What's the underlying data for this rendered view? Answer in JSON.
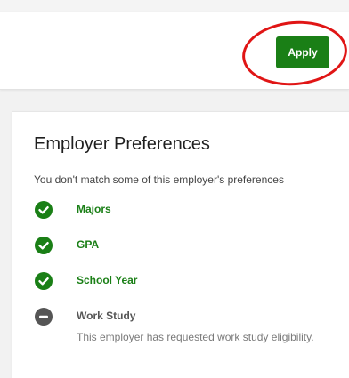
{
  "header": {
    "apply_label": "Apply"
  },
  "preferences": {
    "title": "Employer Preferences",
    "subtitle": "You don't match some of this employer's preferences",
    "items": [
      {
        "label": "Majors",
        "status": "matched",
        "icon": "check-circle-icon"
      },
      {
        "label": "GPA",
        "status": "matched",
        "icon": "check-circle-icon"
      },
      {
        "label": "School Year",
        "status": "matched",
        "icon": "check-circle-icon"
      },
      {
        "label": "Work Study",
        "status": "unmatched",
        "icon": "minus-circle-icon",
        "description": "This employer has requested work study eligibility."
      }
    ]
  },
  "colors": {
    "accent_green": "#1a7f16",
    "unmatched_gray": "#555555",
    "annotation_red": "#e01515"
  }
}
